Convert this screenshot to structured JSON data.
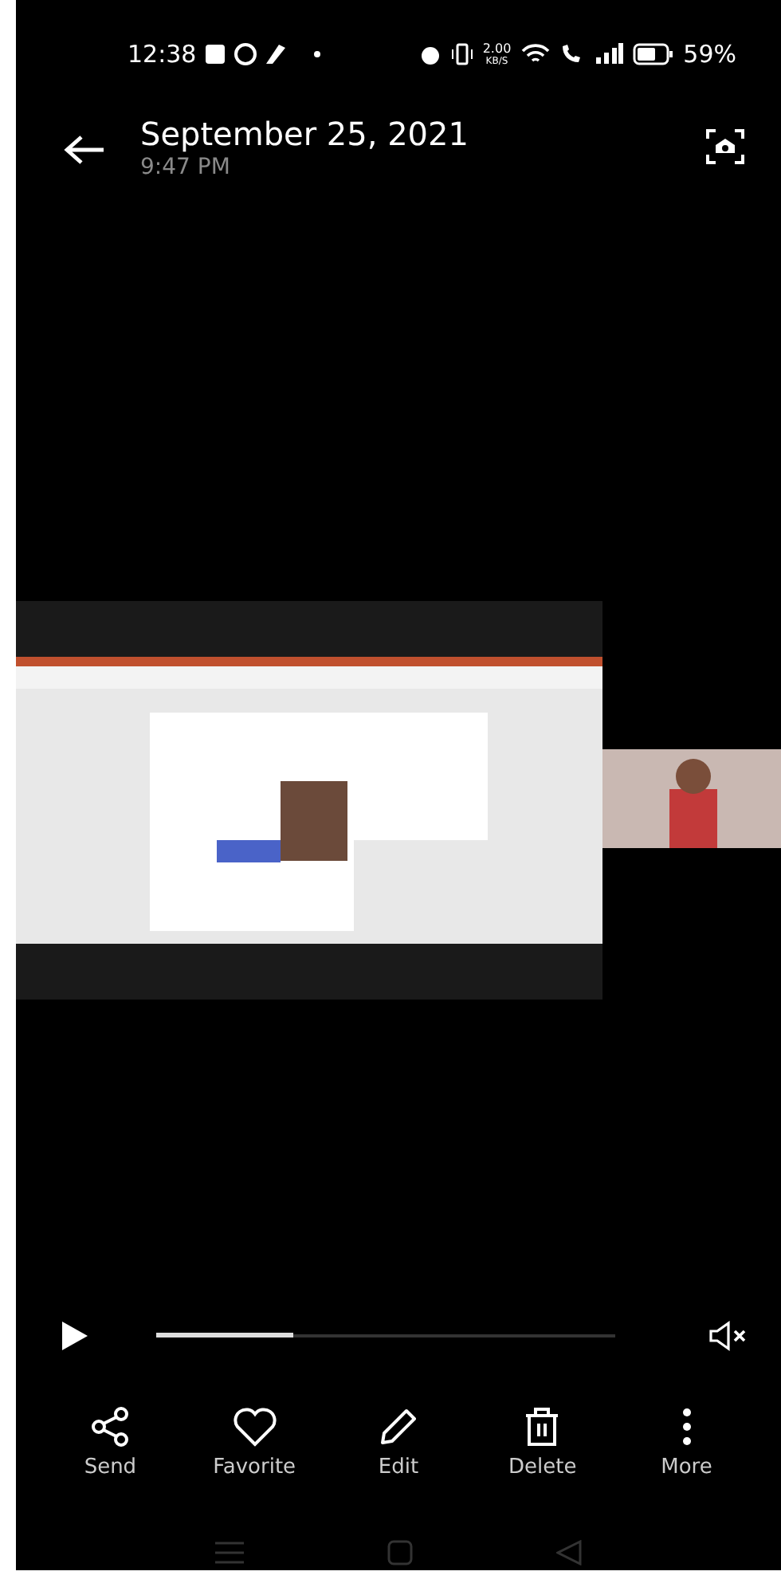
{
  "status_bar": {
    "time": "12:38",
    "speed_value": "2.00",
    "speed_unit": "KB/S",
    "battery": "59%"
  },
  "header": {
    "title": "September 25, 2021",
    "subtitle": "9:47 PM"
  },
  "player": {
    "level": 0.3
  },
  "actions": [
    {
      "kind": "send",
      "label": "Send"
    },
    {
      "kind": "favorite",
      "label": "Favorite"
    },
    {
      "kind": "edit",
      "label": "Edit"
    },
    {
      "kind": "delete",
      "label": "Delete"
    },
    {
      "kind": "more",
      "label": "More"
    }
  ]
}
